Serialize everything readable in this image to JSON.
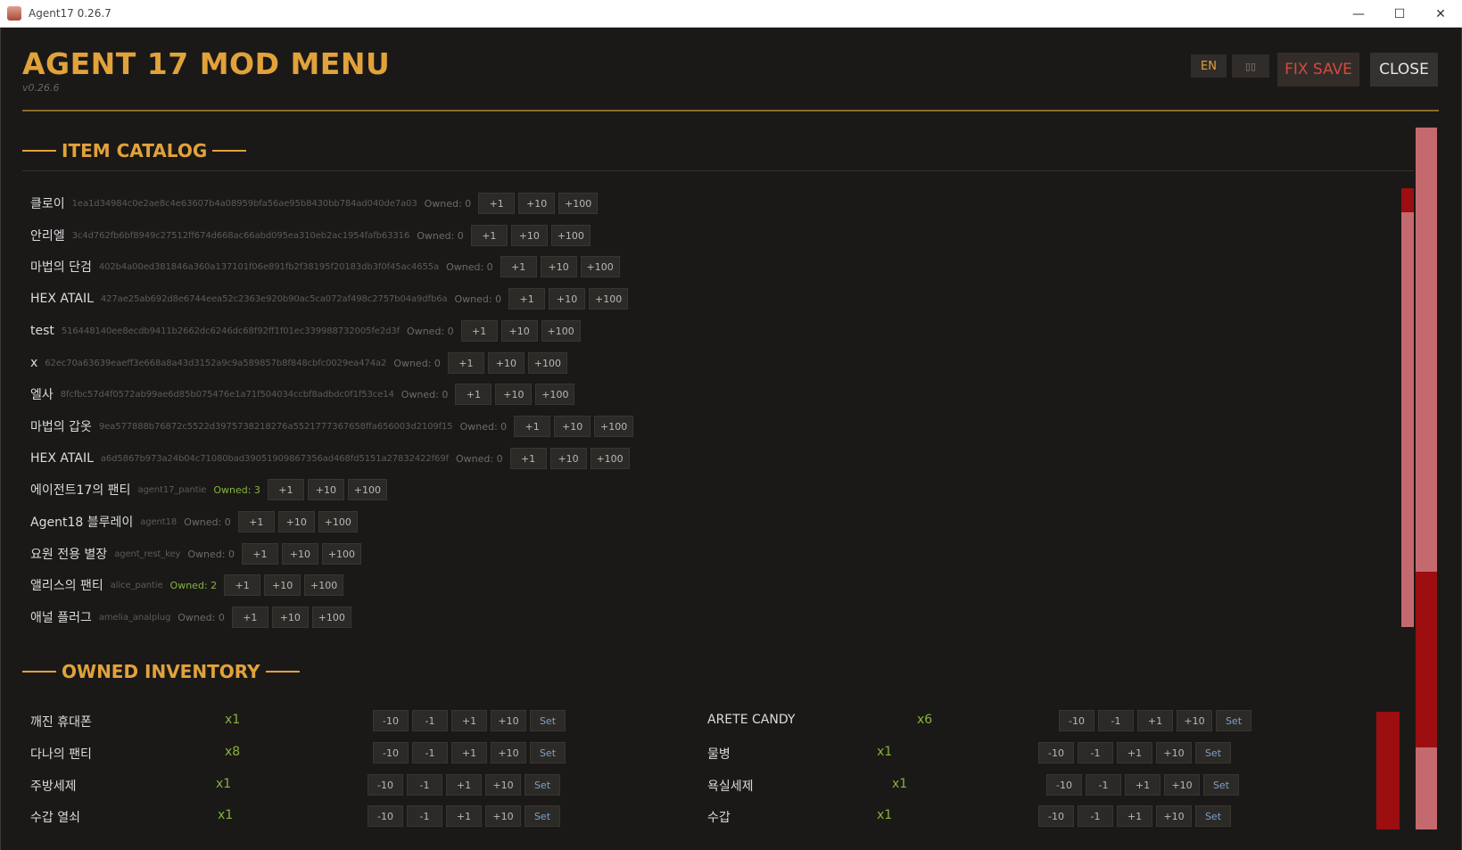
{
  "window": {
    "title": "Agent17 0.26.7",
    "controls": {
      "minimize": "—",
      "maximize": "☐",
      "close": "✕"
    }
  },
  "header": {
    "title": "AGENT 17 MOD MENU",
    "version": "v0.26.6",
    "lang_en": "EN",
    "lang_ko": "▯▯",
    "fix_save": "FIX SAVE",
    "close": "CLOSE"
  },
  "catalog": {
    "title": "ITEM CATALOG",
    "btn_plus1": "+1",
    "btn_plus10": "+10",
    "btn_plus100": "+100",
    "items": [
      {
        "name": "클로이",
        "id": "1ea1d34984c0e2ae8c4e63607b4a08959bfa56ae95b8430bb784ad040de7a03",
        "owned": "Owned: 0"
      },
      {
        "name": "안리엘",
        "id": "3c4d762fb6bf8949c27512ff674d668ac66abd095ea310eb2ac1954fafb63316",
        "owned": "Owned: 0"
      },
      {
        "name": "마법의 단검",
        "id": "402b4a00ed381846a360a137101f06e891fb2f38195f20183db3f0f45ac4655a",
        "owned": "Owned: 0"
      },
      {
        "name": "HEX ATAIL",
        "id": "427ae25ab692d8e6744eea52c2363e920b90ac5ca072af498c2757b04a9dfb6a",
        "owned": "Owned: 0"
      },
      {
        "name": "test",
        "id": "516448140ee8ecdb9411b2662dc6246dc68f92ff1f01ec339988732005fe2d3f",
        "owned": "Owned: 0"
      },
      {
        "name": "x",
        "id": "62ec70a63639eaeff3e668a8a43d3152a9c9a589857b8f848cbfc0029ea474a2",
        "owned": "Owned: 0"
      },
      {
        "name": "엘사",
        "id": "8fcfbc57d4f0572ab99ae6d85b075476e1a71f504034ccbf8adbdc0f1f53ce14",
        "owned": "Owned: 0"
      },
      {
        "name": "마법의 갑옷",
        "id": "9ea577888b76872c5522d3975738218276a5521777367658ffa656003d2109f15",
        "owned": "Owned: 0"
      },
      {
        "name": "HEX ATAIL",
        "id": "a6d5867b973a24b04c71080bad39051909867356ad468fd5151a27832422f69f",
        "owned": "Owned: 0"
      },
      {
        "name": "에이전트17의 팬티",
        "id": "agent17_pantie",
        "owned": "Owned: 3"
      },
      {
        "name": "Agent18 블루레이",
        "id": "agent18",
        "owned": "Owned: 0"
      },
      {
        "name": "요원 전용 별장",
        "id": "agent_rest_key",
        "owned": "Owned: 0"
      },
      {
        "name": "앨리스의 팬티",
        "id": "alice_pantie",
        "owned": "Owned: 2"
      },
      {
        "name": "애널 플러그",
        "id": "amelia_analplug",
        "owned": "Owned: 0"
      }
    ]
  },
  "inventory": {
    "title": "OWNED INVENTORY",
    "btn_m10": "-10",
    "btn_m1": "-1",
    "btn_p1": "+1",
    "btn_p10": "+10",
    "btn_set": "Set",
    "left": [
      {
        "name": "깨진 휴대폰",
        "qty": "x1"
      },
      {
        "name": "다나의 팬티",
        "qty": "x8"
      },
      {
        "name": "주방세제",
        "qty": "x1"
      },
      {
        "name": "수갑 열쇠",
        "qty": "x1"
      }
    ],
    "right": [
      {
        "name": "ARETE CANDY",
        "qty": "x6"
      },
      {
        "name": "물병",
        "qty": "x1"
      },
      {
        "name": "욕실세제",
        "qty": "x1"
      },
      {
        "name": "수갑",
        "qty": "x1"
      }
    ]
  },
  "colors": {
    "accent": "#e2a23a",
    "owned_green": "#86b33c",
    "danger": "#d24a3e",
    "scroll_track": "#c46a6e",
    "scroll_thumb": "#9c0e10",
    "background": "#1a1918"
  }
}
